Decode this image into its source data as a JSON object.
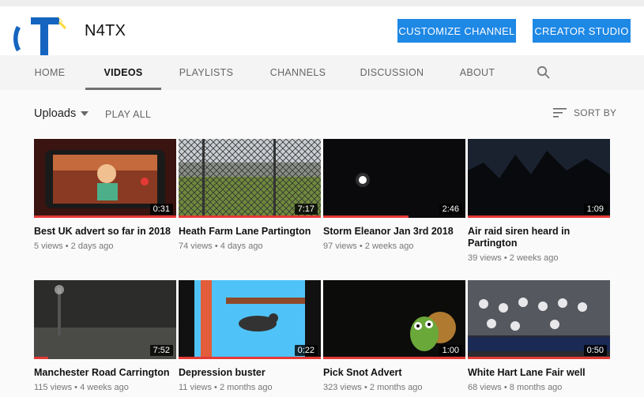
{
  "channel": {
    "name": "N4TX"
  },
  "header": {
    "customize_label": "CUSTOMIZE CHANNEL",
    "studio_label": "CREATOR STUDIO"
  },
  "tabs": [
    {
      "label": "HOME"
    },
    {
      "label": "VIDEOS"
    },
    {
      "label": "PLAYLISTS"
    },
    {
      "label": "CHANNELS"
    },
    {
      "label": "DISCUSSION"
    },
    {
      "label": "ABOUT"
    }
  ],
  "toolbar": {
    "uploads_label": "Uploads",
    "play_all_label": "PLAY ALL",
    "sort_label": "SORT BY"
  },
  "colors": {
    "accent_button": "#1e88e5",
    "progress": "#e53935"
  },
  "videos": [
    {
      "title": "Best UK advert so far in 2018",
      "views": "5 views",
      "age": "2 days ago",
      "duration": "0:31",
      "watched": 1.0
    },
    {
      "title": "Heath Farm Lane Partington",
      "views": "74 views",
      "age": "4 days ago",
      "duration": "7:17",
      "watched": 1.0
    },
    {
      "title": "Storm Eleanor Jan 3rd 2018",
      "views": "97 views",
      "age": "2 weeks ago",
      "duration": "2:46",
      "watched": 0.6
    },
    {
      "title": "Air raid siren heard in Partington",
      "views": "39 views",
      "age": "2 weeks ago",
      "duration": "1:09",
      "watched": 1.0
    },
    {
      "title": "Manchester Road Carrington",
      "views": "115 views",
      "age": "4 weeks ago",
      "duration": "7:52",
      "watched": 0.1
    },
    {
      "title": "Depression buster",
      "views": "11 views",
      "age": "2 months ago",
      "duration": "0:22",
      "watched": 1.0
    },
    {
      "title": "Pick Snot Advert",
      "views": "323 views",
      "age": "2 months ago",
      "duration": "1:00",
      "watched": 1.0
    },
    {
      "title": "White Hart Lane Fair well",
      "views": "68 views",
      "age": "8 months ago",
      "duration": "0:50",
      "watched": 1.0
    }
  ]
}
